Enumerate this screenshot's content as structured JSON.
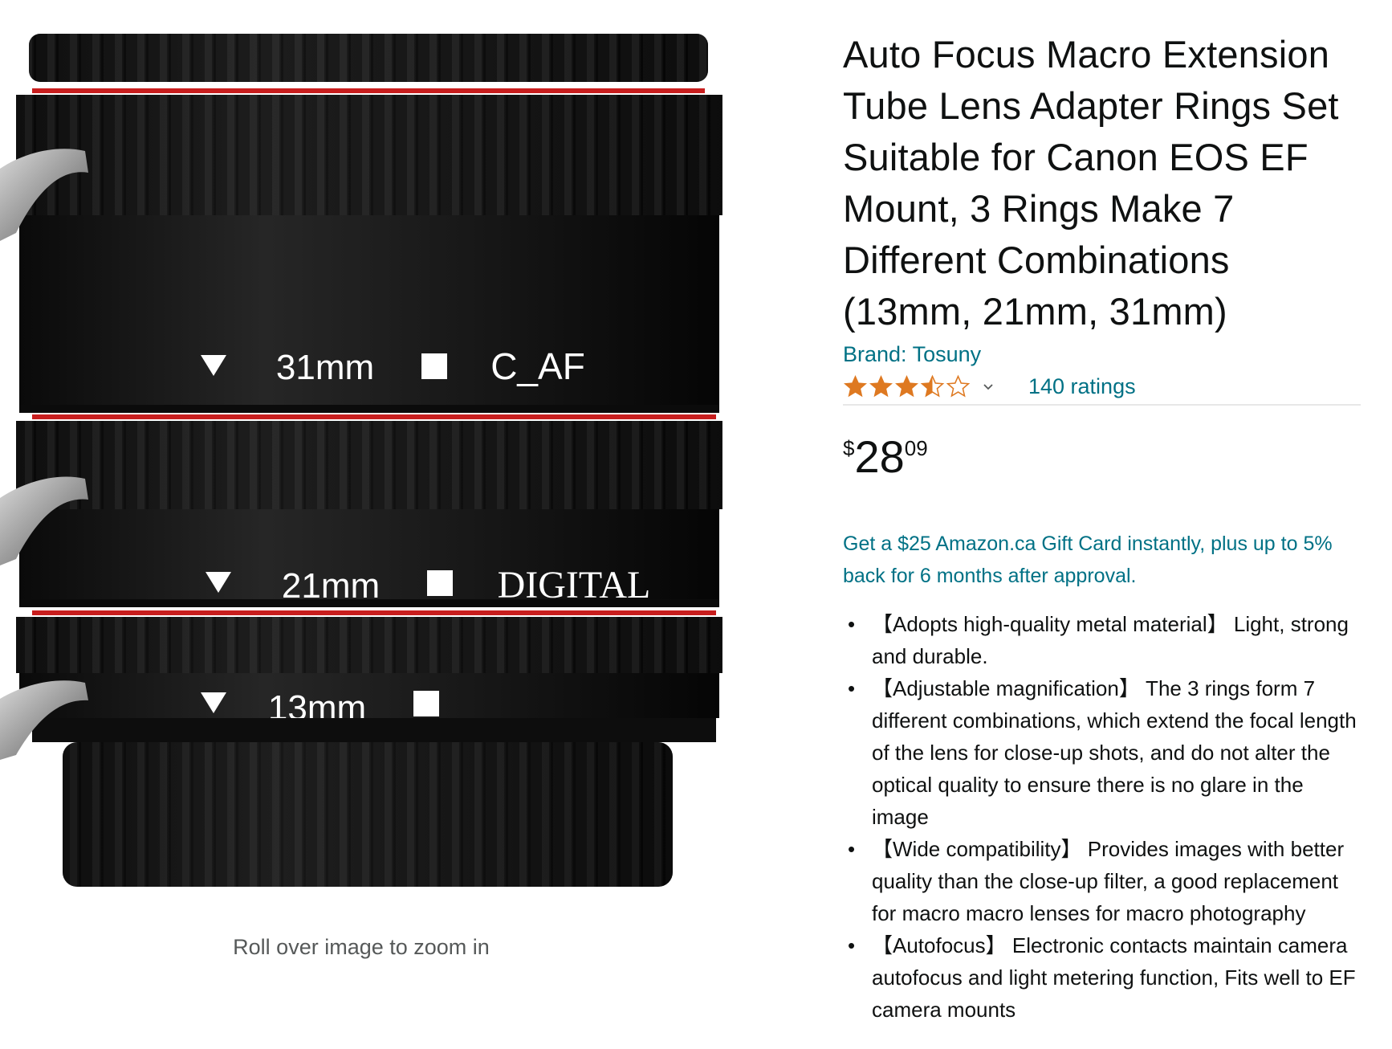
{
  "image": {
    "alt": "Macro extension tube rings",
    "ring_labels": {
      "top_size": "31mm",
      "top_tag": "C_AF",
      "middle_size": "21mm",
      "middle_tag": "DIGITAL",
      "bottom_size": "13mm"
    },
    "zoom_hint": "Roll over image to zoom in"
  },
  "product": {
    "title": "Auto Focus Macro Extension Tube Lens Adapter Rings Set Suitable for Canon EOS EF Mount, 3 Rings Make 7 Different Combinations (13mm, 21mm, 31mm)",
    "brand": "Brand: Tosuny",
    "rating_stars": 3.5,
    "ratings_count": "140 ratings",
    "price": {
      "symbol": "$",
      "whole": "28",
      "fraction": "09"
    },
    "promo": "Get a $25 Amazon.ca Gift Card instantly, plus up to 5% back for 6 months after approval.",
    "bullets": [
      "【Adopts high-quality metal material】 Light, strong and durable.",
      "【Adjustable magnification】 The 3 rings form 7 different combinations, which extend the focal length of the lens for close-up shots, and do not alter the optical quality to ensure there is no glare in the image",
      "【Wide compatibility】 Provides images with better quality than the close-up filter, a good replacement for macro macro lenses for macro photography",
      "【Autofocus】 Electronic contacts maintain camera autofocus and light metering function, Fits well to EF camera mounts"
    ]
  },
  "colors": {
    "link": "#007185",
    "star": "#de7921",
    "ring_red": "#c81e1e",
    "ring_black": "#111111"
  }
}
